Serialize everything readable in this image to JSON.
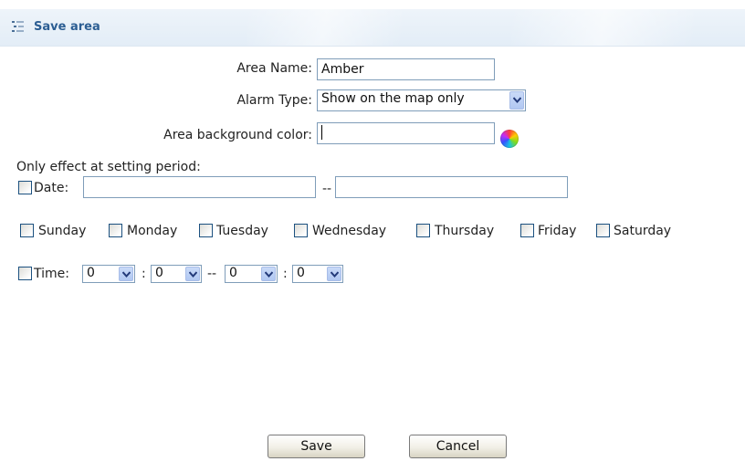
{
  "title": {
    "text": "Save area",
    "icon": "list-icon"
  },
  "form": {
    "area_name": {
      "label": "Area Name:",
      "value": "Amber"
    },
    "alarm_type": {
      "label": "Alarm Type:",
      "selected": "Show on the map only"
    },
    "bg_color": {
      "label": "Area background color:",
      "value": "",
      "picker_icon": "color-wheel-icon"
    },
    "period_label": "Only effect at setting period:",
    "date": {
      "label": "Date:",
      "separator": "--",
      "from": "",
      "to": "",
      "checked": false
    },
    "days": [
      {
        "label": "Sunday",
        "checked": false
      },
      {
        "label": "Monday",
        "checked": false
      },
      {
        "label": "Tuesday",
        "checked": false
      },
      {
        "label": "Wednesday",
        "checked": false
      },
      {
        "label": "Thursday",
        "checked": false
      },
      {
        "label": "Friday",
        "checked": false
      },
      {
        "label": "Saturday",
        "checked": false
      }
    ],
    "time": {
      "label": "Time:",
      "checked": false,
      "start_hour": "0",
      "start_min": "0",
      "end_hour": "0",
      "end_min": "0",
      "colon": ":",
      "range_sep": "--"
    }
  },
  "buttons": {
    "save": "Save",
    "cancel": "Cancel"
  }
}
